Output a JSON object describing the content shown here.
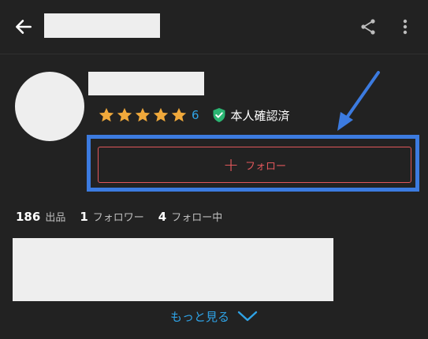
{
  "profile": {
    "rating_count": "6",
    "verified_label": "本人確認済",
    "follow_plus": "+",
    "follow_label": "フォロー"
  },
  "stats": [
    {
      "value": "186",
      "label": "出品"
    },
    {
      "value": "1",
      "label": "フォロワー"
    },
    {
      "value": "4",
      "label": "フォロー中"
    }
  ],
  "see_more_label": "もっと見る",
  "icons": {
    "back": "arrow-left-icon",
    "share": "share-icon",
    "more": "more-vertical-icon",
    "star": "star-icon",
    "verified": "shield-check-icon",
    "expand": "chevron-down-icon"
  },
  "colors": {
    "background": "#222222",
    "accent_blue": "#2fa3e6",
    "follow_red": "#e0575b",
    "star_gold": "#f0a93b",
    "verified_green": "#2bb673",
    "highlight_blue": "#3c7be0"
  }
}
